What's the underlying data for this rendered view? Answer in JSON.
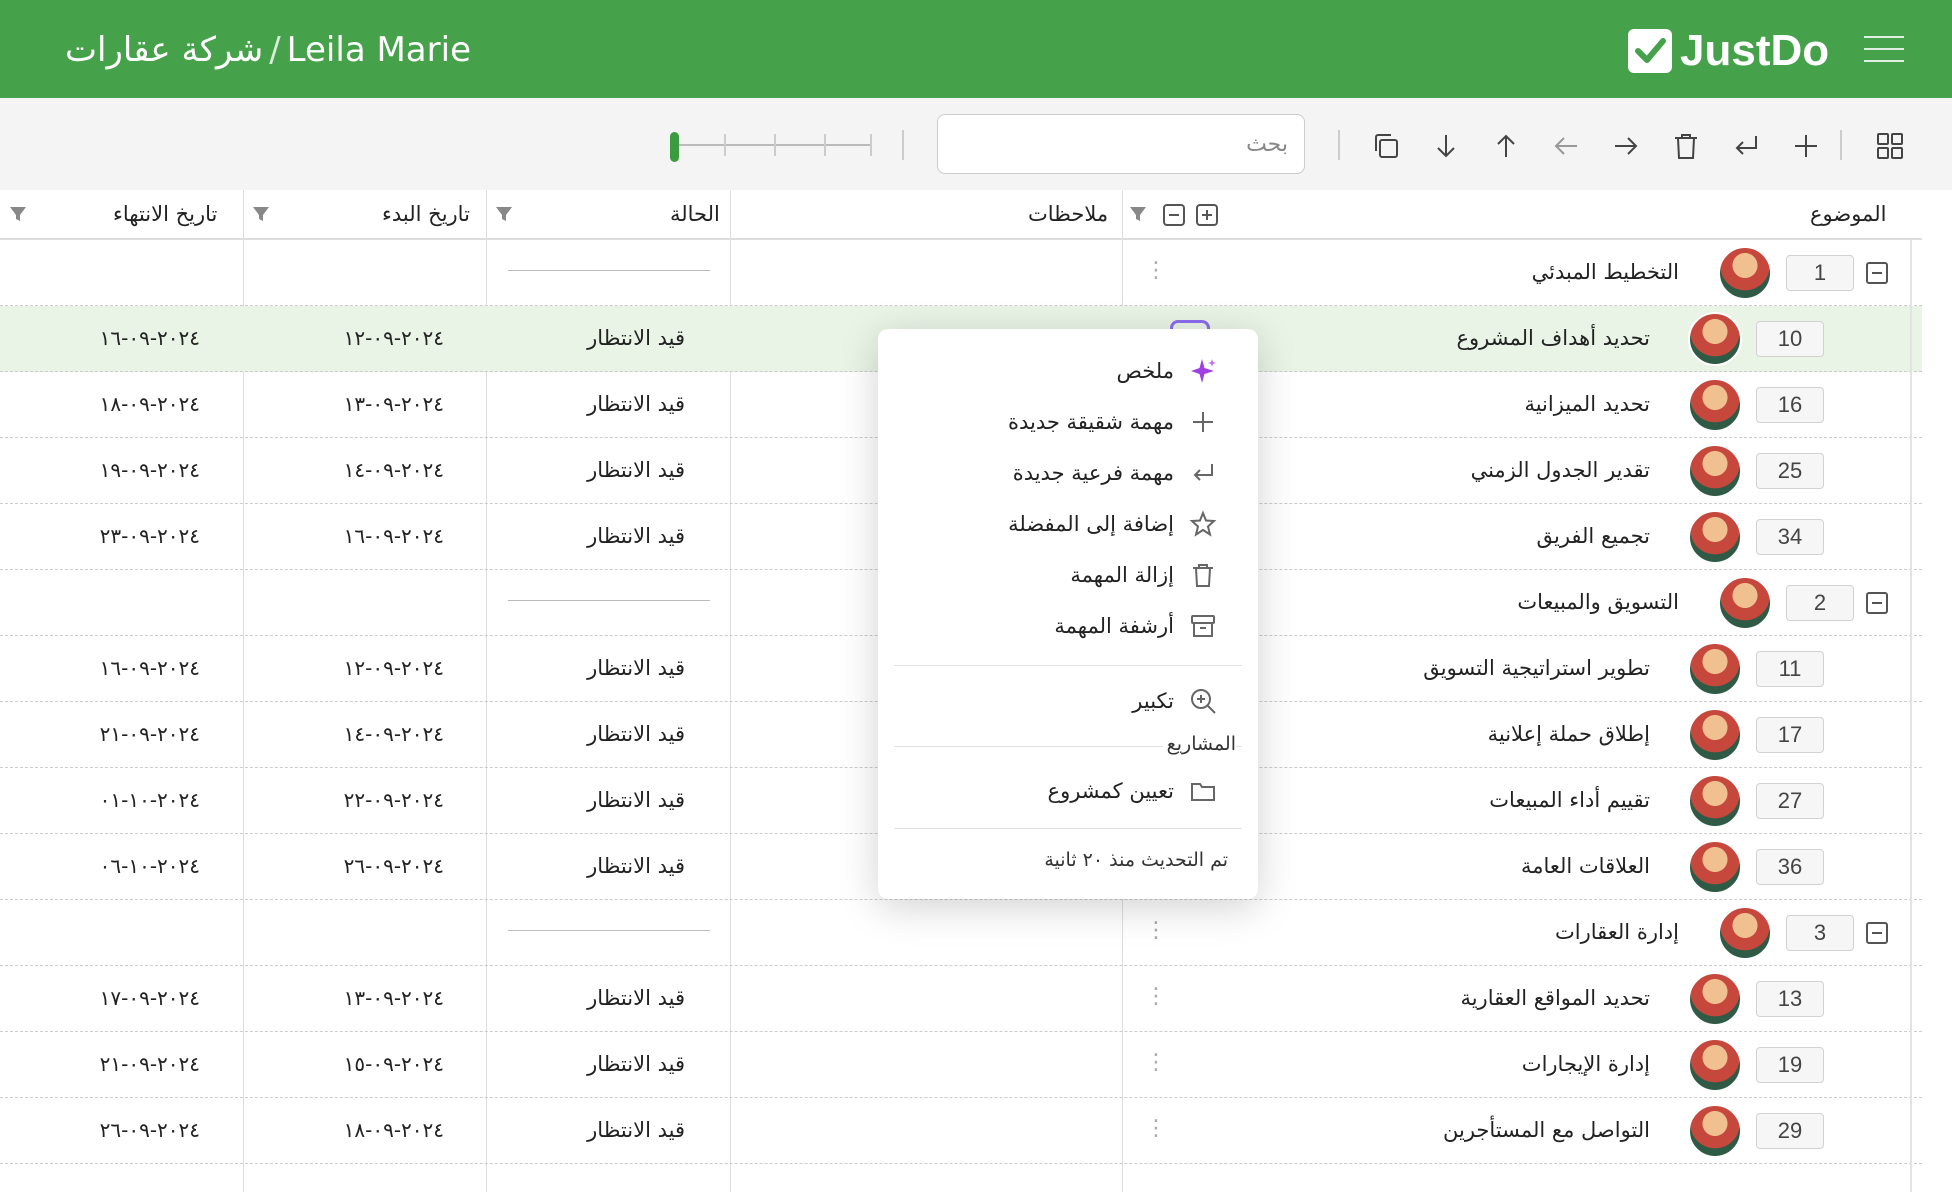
{
  "header": {
    "user": "Leila Marie",
    "separator": "/",
    "workspace": "شركة عقارات",
    "logo_text": "JustDo",
    "menu_icon": "hamburger-icon"
  },
  "toolbar": {
    "search_placeholder": "بحث",
    "zoom_level": 0,
    "icons": [
      "grid-view-icon",
      "add-icon",
      "add-child-icon",
      "delete-icon",
      "move-right-icon",
      "move-left-icon",
      "move-up-icon",
      "move-down-icon",
      "duplicate-icon"
    ]
  },
  "columns": {
    "subject": "الموضوع",
    "notes": "ملاحظات",
    "status": "الحالة",
    "start_date": "تاريخ البدء",
    "end_date": "تاريخ الانتهاء"
  },
  "rows": [
    {
      "seq": "1",
      "title": "التخطيط المبدئي",
      "parent": true,
      "status": "",
      "start": "",
      "end": ""
    },
    {
      "seq": "10",
      "title": "تحديد أهداف المشروع",
      "parent": false,
      "status": "قيد الانتظار",
      "start": "٢٠٢٤-٠٩-١٢",
      "end": "٢٠٢٤-٠٩-١٦",
      "selected": true
    },
    {
      "seq": "16",
      "title": "تحديد الميزانية",
      "parent": false,
      "status": "قيد الانتظار",
      "start": "٢٠٢٤-٠٩-١٣",
      "end": "٢٠٢٤-٠٩-١٨"
    },
    {
      "seq": "25",
      "title": "تقدير الجدول الزمني",
      "parent": false,
      "status": "قيد الانتظار",
      "start": "٢٠٢٤-٠٩-١٤",
      "end": "٢٠٢٤-٠٩-١٩"
    },
    {
      "seq": "34",
      "title": "تجميع الفريق",
      "parent": false,
      "status": "قيد الانتظار",
      "start": "٢٠٢٤-٠٩-١٦",
      "end": "٢٠٢٤-٠٩-٢٣"
    },
    {
      "seq": "2",
      "title": "التسويق والمبيعات",
      "parent": true,
      "status": "",
      "start": "",
      "end": ""
    },
    {
      "seq": "11",
      "title": "تطوير استراتيجية التسويق",
      "parent": false,
      "status": "قيد الانتظار",
      "start": "٢٠٢٤-٠٩-١٢",
      "end": "٢٠٢٤-٠٩-١٦"
    },
    {
      "seq": "17",
      "title": "إطلاق حملة إعلانية",
      "parent": false,
      "status": "قيد الانتظار",
      "start": "٢٠٢٤-٠٩-١٤",
      "end": "٢٠٢٤-٠٩-٢١"
    },
    {
      "seq": "27",
      "title": "تقييم أداء المبيعات",
      "parent": false,
      "status": "قيد الانتظار",
      "start": "٢٠٢٤-٠٩-٢٢",
      "end": "٢٠٢٤-١٠-٠١"
    },
    {
      "seq": "36",
      "title": "العلاقات العامة",
      "parent": false,
      "status": "قيد الانتظار",
      "start": "٢٠٢٤-٠٩-٢٦",
      "end": "٢٠٢٤-١٠-٠٦"
    },
    {
      "seq": "3",
      "title": "إدارة العقارات",
      "parent": true,
      "status": "",
      "start": "",
      "end": ""
    },
    {
      "seq": "13",
      "title": "تحديد المواقع العقارية",
      "parent": false,
      "status": "قيد الانتظار",
      "start": "٢٠٢٤-٠٩-١٣",
      "end": "٢٠٢٤-٠٩-١٧"
    },
    {
      "seq": "19",
      "title": "إدارة الإيجارات",
      "parent": false,
      "status": "قيد الانتظار",
      "start": "٢٠٢٤-٠٩-١٥",
      "end": "٢٠٢٤-٠٩-٢١"
    },
    {
      "seq": "29",
      "title": "التواصل مع المستأجرين",
      "parent": false,
      "status": "قيد الانتظار",
      "start": "٢٠٢٤-٠٩-١٨",
      "end": "٢٠٢٤-٠٩-٢٦"
    }
  ],
  "context_menu": {
    "summary": "ملخص",
    "new_sibling": "مهمة شقيقة جديدة",
    "new_child": "مهمة فرعية جديدة",
    "add_favorite": "إضافة إلى المفضلة",
    "remove_task": "إزالة المهمة",
    "archive_task": "أرشفة المهمة",
    "zoom_in": "تكبير",
    "projects_section": "المشاريع",
    "set_as_project": "تعيين كمشروع",
    "updated": "تم التحديث منذ ٢٠ ثانية"
  },
  "colors": {
    "brand": "#46a24a",
    "selected_row": "#e9f4e6",
    "ai_accent": "#a040e0"
  }
}
